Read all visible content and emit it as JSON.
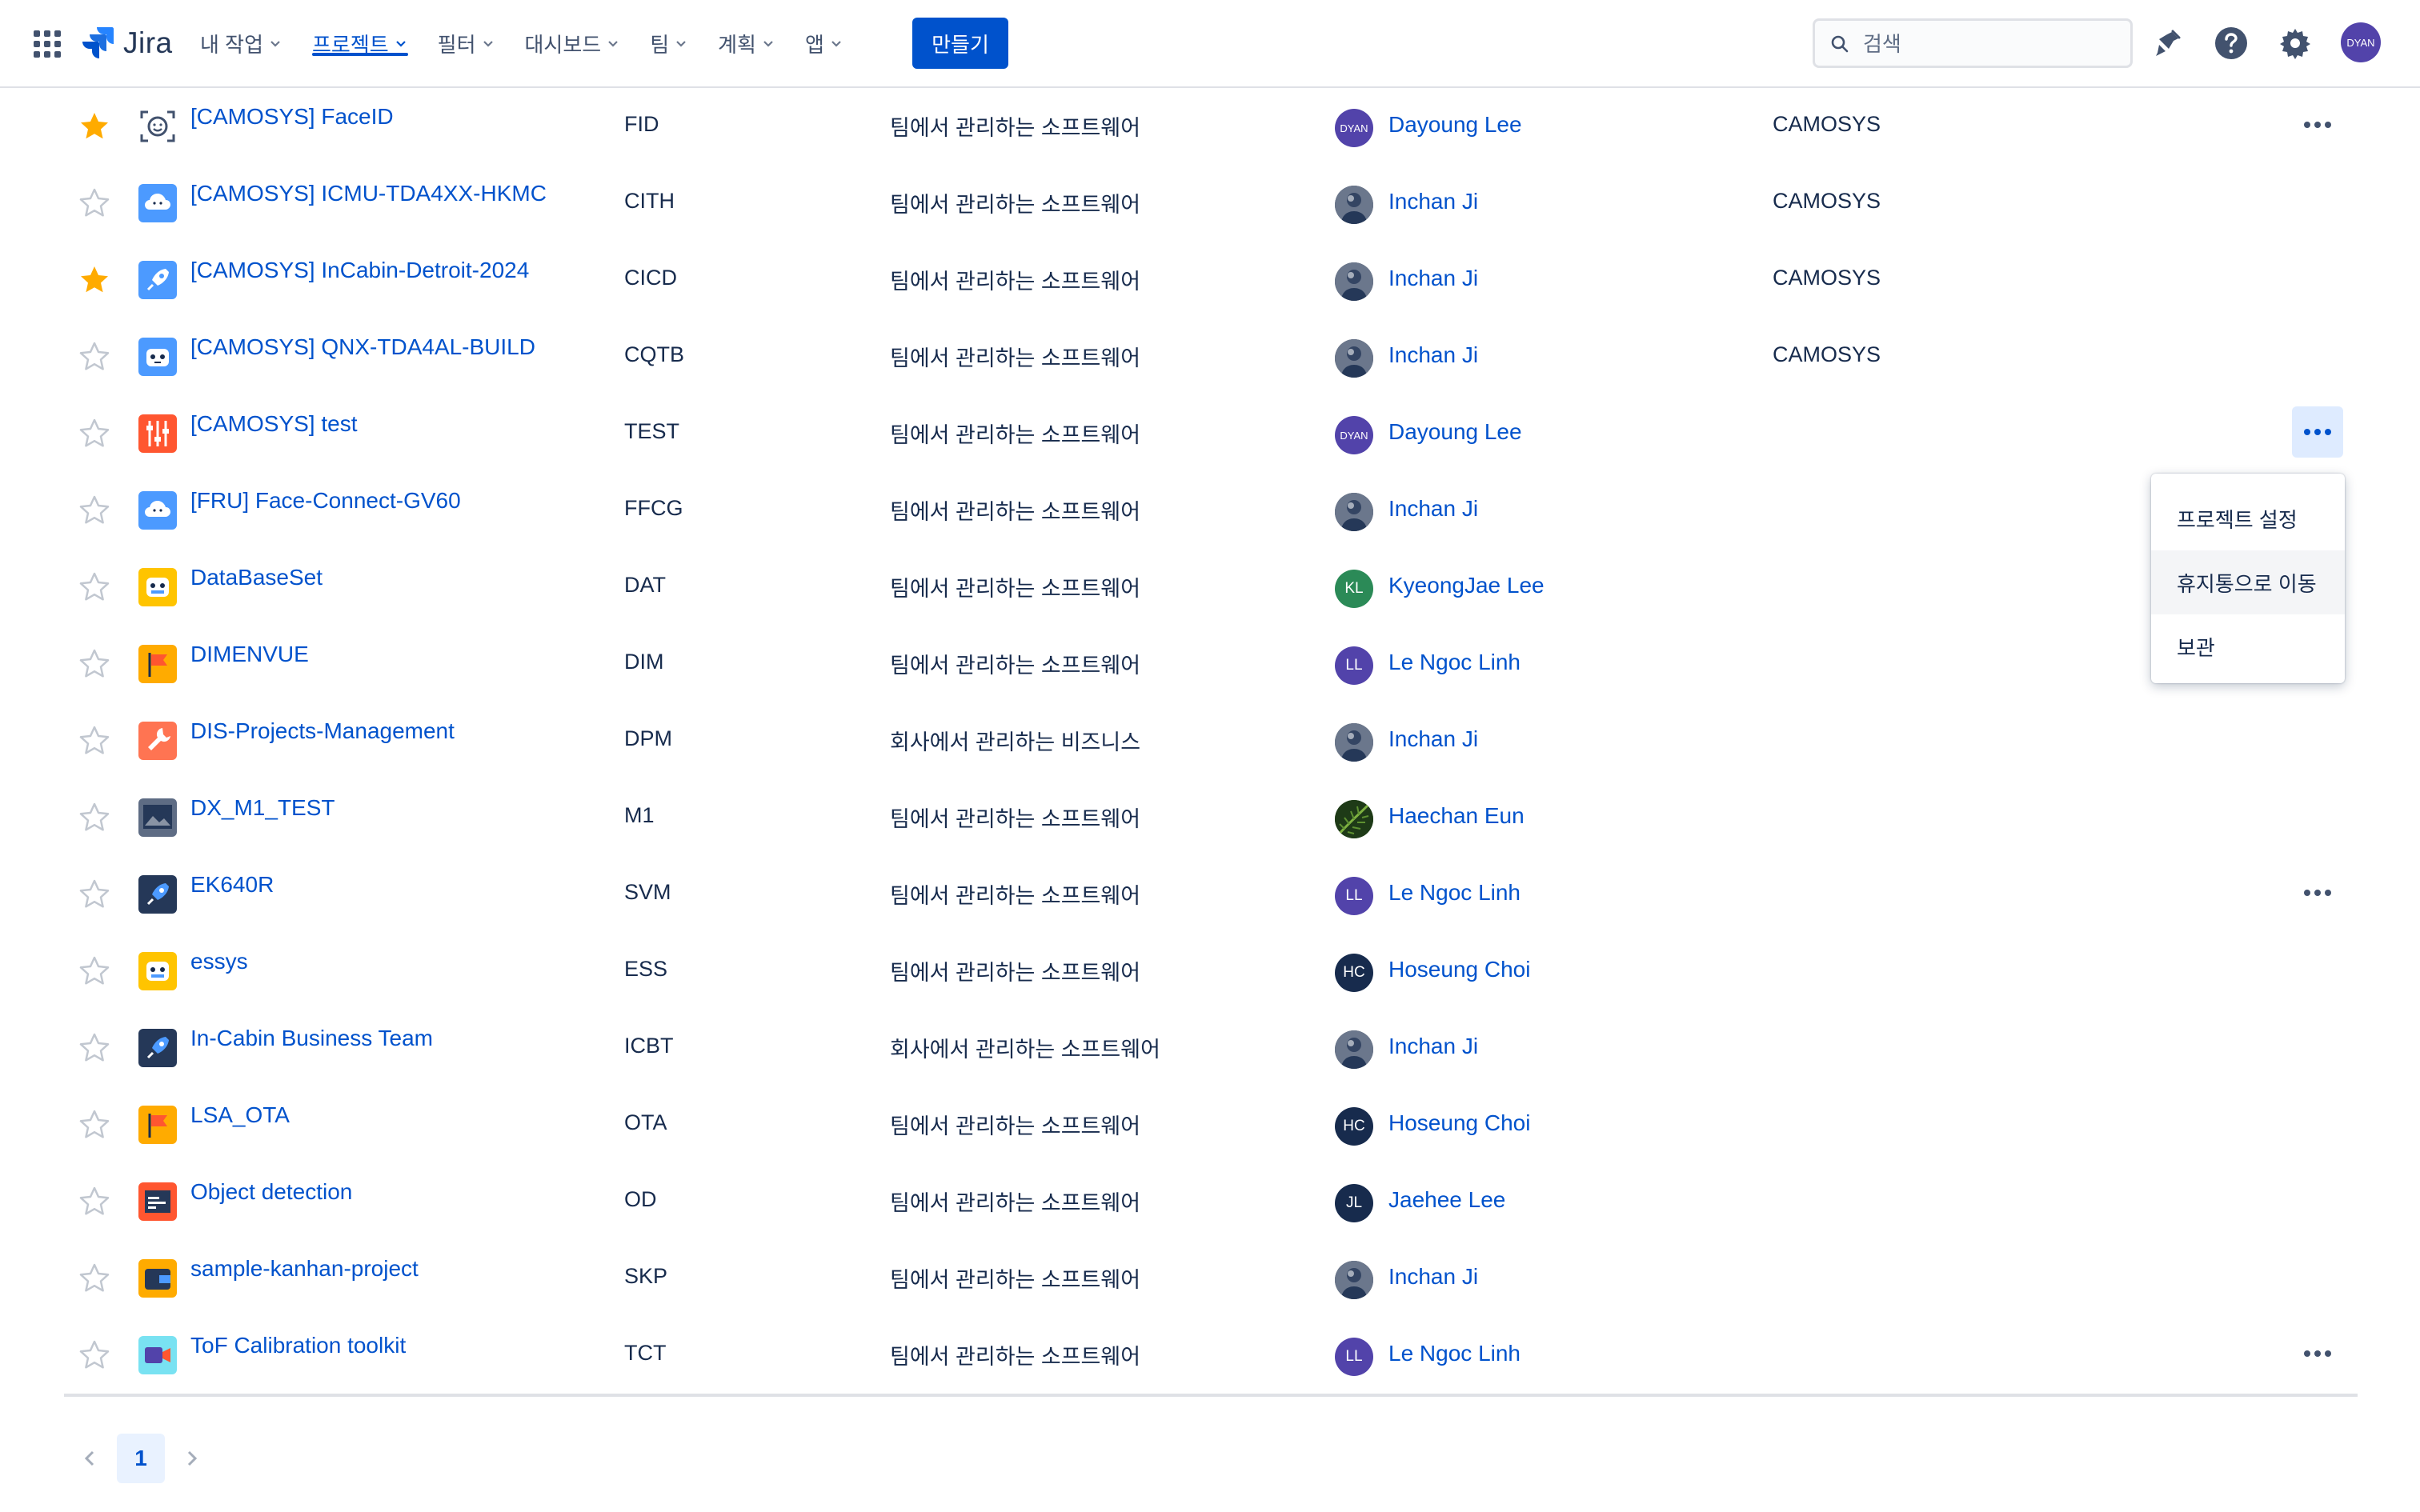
{
  "nav": {
    "logo_text": "Jira",
    "items": [
      {
        "label": "내 작업",
        "active": false
      },
      {
        "label": "프로젝트",
        "active": true
      },
      {
        "label": "필터",
        "active": false
      },
      {
        "label": "대시보드",
        "active": false
      },
      {
        "label": "팀",
        "active": false
      },
      {
        "label": "계획",
        "active": false
      },
      {
        "label": "앱",
        "active": false
      }
    ],
    "create_label": "만들기",
    "search_placeholder": "검색",
    "user_avatar": "DYAN"
  },
  "projects": [
    {
      "starred": true,
      "icon": "face-id-icon",
      "name": "[CAMOSYS] FaceID",
      "key": "FID",
      "type": "팀에서 관리하는 소프트웨어",
      "lead": "Dayoung Lee",
      "lead_avatar": "DYAN",
      "lead_color": "#5243aa",
      "category": "CAMOSYS",
      "more": true,
      "more_open": false
    },
    {
      "starred": false,
      "icon": "cloud-icon",
      "name": "[CAMOSYS] ICMU-TDA4XX-HKMC",
      "key": "CITH",
      "type": "팀에서 관리하는 소프트웨어",
      "lead": "Inchan Ji",
      "lead_avatar": "",
      "lead_color": "#3d4752",
      "category": "CAMOSYS",
      "more": false,
      "more_open": false
    },
    {
      "starred": true,
      "icon": "rocket-icon",
      "name": "[CAMOSYS] InCabin-Detroit-2024",
      "key": "CICD",
      "type": "팀에서 관리하는 소프트웨어",
      "lead": "Inchan Ji",
      "lead_avatar": "",
      "lead_color": "#3d4752",
      "category": "CAMOSYS",
      "more": false,
      "more_open": false
    },
    {
      "starred": false,
      "icon": "robot-icon",
      "name": "[CAMOSYS] QNX-TDA4AL-BUILD",
      "key": "CQTB",
      "type": "팀에서 관리하는 소프트웨어",
      "lead": "Inchan Ji",
      "lead_avatar": "",
      "lead_color": "#3d4752",
      "category": "CAMOSYS",
      "more": false,
      "more_open": false
    },
    {
      "starred": false,
      "icon": "sliders-icon",
      "name": "[CAMOSYS] test",
      "key": "TEST",
      "type": "팀에서 관리하는 소프트웨어",
      "lead": "Dayoung Lee",
      "lead_avatar": "DYAN",
      "lead_color": "#5243aa",
      "category": "",
      "more": true,
      "more_open": true
    },
    {
      "starred": false,
      "icon": "cloud-icon",
      "name": "[FRU] Face-Connect-GV60",
      "key": "FFCG",
      "type": "팀에서 관리하는 소프트웨어",
      "lead": "Inchan Ji",
      "lead_avatar": "",
      "lead_color": "#3d4752",
      "category": "",
      "more": false,
      "more_open": false
    },
    {
      "starred": false,
      "icon": "robot-yellow-icon",
      "name": "DataBaseSet",
      "key": "DAT",
      "type": "팀에서 관리하는 소프트웨어",
      "lead": "KyeongJae Lee",
      "lead_avatar": "KL",
      "lead_color": "#2b8a57",
      "category": "",
      "more": false,
      "more_open": false
    },
    {
      "starred": false,
      "icon": "flag-icon",
      "name": "DIMENVUE",
      "key": "DIM",
      "type": "팀에서 관리하는 소프트웨어",
      "lead": "Le Ngoc Linh",
      "lead_avatar": "LL",
      "lead_color": "#5243aa",
      "category": "",
      "more": false,
      "more_open": false
    },
    {
      "starred": false,
      "icon": "wrench-icon",
      "name": "DIS-Projects-Management",
      "key": "DPM",
      "type": "회사에서 관리하는 비즈니스",
      "lead": "Inchan Ji",
      "lead_avatar": "",
      "lead_color": "#3d4752",
      "category": "",
      "more": false,
      "more_open": false
    },
    {
      "starred": false,
      "icon": "photo-icon",
      "name": "DX_M1_TEST",
      "key": "M1",
      "type": "팀에서 관리하는 소프트웨어",
      "lead": "Haechan Eun",
      "lead_avatar": "",
      "lead_color": "#2f5e2a",
      "category": "",
      "more": false,
      "more_open": false
    },
    {
      "starred": false,
      "icon": "rocket-dark-icon",
      "name": "EK640R",
      "key": "SVM",
      "type": "팀에서 관리하는 소프트웨어",
      "lead": "Le Ngoc Linh",
      "lead_avatar": "LL",
      "lead_color": "#5243aa",
      "category": "",
      "more": true,
      "more_open": false
    },
    {
      "starred": false,
      "icon": "robot-yellow-icon",
      "name": "essys",
      "key": "ESS",
      "type": "팀에서 관리하는 소프트웨어",
      "lead": "Hoseung Choi",
      "lead_avatar": "HC",
      "lead_color": "#172b4d",
      "category": "",
      "more": false,
      "more_open": false
    },
    {
      "starred": false,
      "icon": "rocket-dark-icon",
      "name": "In-Cabin Business Team",
      "key": "ICBT",
      "type": "회사에서 관리하는 소프트웨어",
      "lead": "Inchan Ji",
      "lead_avatar": "",
      "lead_color": "#3d4752",
      "category": "",
      "more": false,
      "more_open": false
    },
    {
      "starred": false,
      "icon": "flag-icon",
      "name": "LSA_OTA",
      "key": "OTA",
      "type": "팀에서 관리하는 소프트웨어",
      "lead": "Hoseung Choi",
      "lead_avatar": "HC",
      "lead_color": "#172b4d",
      "category": "",
      "more": false,
      "more_open": false
    },
    {
      "starred": false,
      "icon": "window-icon",
      "name": "Object detection",
      "key": "OD",
      "type": "팀에서 관리하는 소프트웨어",
      "lead": "Jaehee Lee",
      "lead_avatar": "JL",
      "lead_color": "#172b4d",
      "category": "",
      "more": false,
      "more_open": false
    },
    {
      "starred": false,
      "icon": "wallet-icon",
      "name": "sample-kanhan-project",
      "key": "SKP",
      "type": "팀에서 관리하는 소프트웨어",
      "lead": "Inchan Ji",
      "lead_avatar": "",
      "lead_color": "#3d4752",
      "category": "",
      "more": false,
      "more_open": false
    },
    {
      "starred": false,
      "icon": "camera-icon",
      "name": "ToF Calibration toolkit",
      "key": "TCT",
      "type": "팀에서 관리하는 소프트웨어",
      "lead": "Le Ngoc Linh",
      "lead_avatar": "LL",
      "lead_color": "#5243aa",
      "category": "",
      "more": true,
      "more_open": false
    }
  ],
  "dropdown": {
    "items": [
      {
        "label": "프로젝트 설정",
        "hover": false
      },
      {
        "label": "휴지통으로 이동",
        "hover": true
      },
      {
        "label": "보관",
        "hover": false
      }
    ]
  },
  "pagination": {
    "current": "1"
  }
}
